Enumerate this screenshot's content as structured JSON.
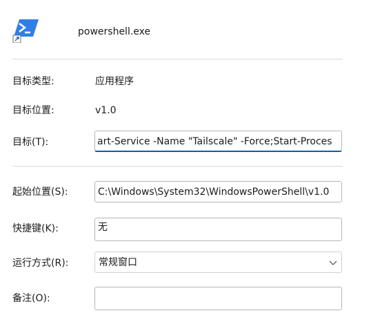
{
  "header": {
    "app_name": "powershell.exe",
    "app_icon": "powershell-shortcut-icon"
  },
  "fields": {
    "target_type": {
      "label": "目标类型:",
      "value": "应用程序"
    },
    "target_location": {
      "label": "目标位置:",
      "value": "v1.0"
    },
    "target": {
      "label": "目标(T):",
      "value": "art-Service -Name \"Tailscale\" -Force;Start-Proces"
    },
    "start_in": {
      "label": "起始位置(S):",
      "value": "C:\\Windows\\System32\\WindowsPowerShell\\v1.0"
    },
    "shortcut_key": {
      "label": "快捷键(K):",
      "value": "无"
    },
    "run": {
      "label": "运行方式(R):",
      "value": "常规窗口"
    },
    "comment": {
      "label": "备注(O):",
      "value": ""
    }
  },
  "colors": {
    "focus_accent": "#005fb8",
    "icon_blue": "#2f7ee8"
  }
}
